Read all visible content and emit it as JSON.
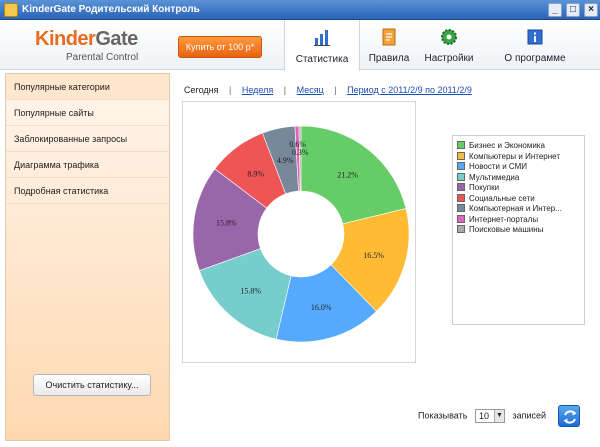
{
  "window": {
    "title": "KinderGate Родительский Контроль",
    "btn_min": "_",
    "btn_max": "□",
    "btn_close": "×"
  },
  "header": {
    "logo_kinder": "Kinder",
    "logo_gate": "Gate",
    "logo_sub": "Parental Control",
    "buy_label": "Купить от 100 р*",
    "tabs": [
      {
        "label": "Статистика",
        "icon": "bar-chart-icon",
        "active": true
      },
      {
        "label": "Правила",
        "icon": "document-icon"
      },
      {
        "label": "Настройки",
        "icon": "gear-icon"
      },
      {
        "label": "О программе",
        "icon": "info-icon"
      }
    ]
  },
  "sidebar": {
    "items": [
      {
        "label": "Популярные категории"
      },
      {
        "label": "Популярные сайты"
      },
      {
        "label": "Заблокированные запросы"
      },
      {
        "label": "Диаграмма трафика"
      },
      {
        "label": "Подробная статистика"
      }
    ],
    "clear_label": "Очистить статистику..."
  },
  "periods": {
    "today": "Сегодня",
    "week": "Неделя",
    "month": "Месяц",
    "range": "Период с 2011/2/9 по 2011/2/9",
    "sep": "|"
  },
  "chart_data": {
    "type": "pie",
    "donut": true,
    "categories": [
      "Бизнес и Экономика",
      "Компьютеры и Интернет",
      "Новости и СМИ",
      "Мультимедиа",
      "Покупки",
      "Социальные сети",
      "Компьютерная и Интер...",
      "Интернет-порталы",
      "Поисковые машины"
    ],
    "values": [
      21.2,
      16.5,
      16.0,
      15.8,
      15.8,
      8.9,
      4.9,
      0.6,
      0.3
    ],
    "labels": [
      "21.2%",
      "16.5%",
      "16.0%",
      "15.8%",
      "15.8%",
      "8.9%",
      "4.9%",
      "0.6%",
      "0.3%"
    ],
    "colors": [
      "#66cc66",
      "#ffbb33",
      "#55aaff",
      "#77cccc",
      "#9966aa",
      "#f05555",
      "#778899",
      "#dd66bb",
      "#aaaaaa"
    ],
    "legend": "right"
  },
  "pager": {
    "show_label": "Показывать",
    "count": "10",
    "records_label": "записей"
  }
}
